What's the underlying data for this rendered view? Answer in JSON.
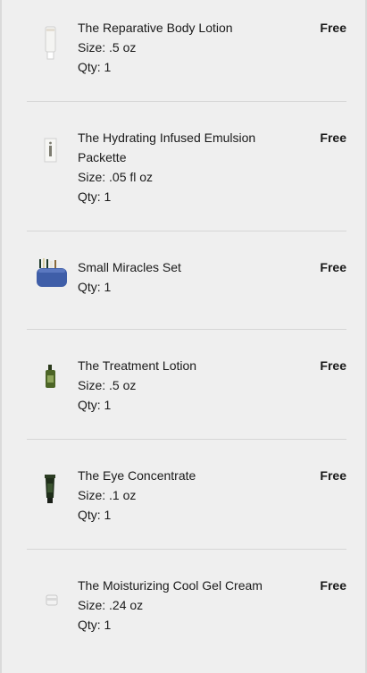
{
  "items": [
    {
      "name": "The Reparative Body Lotion",
      "size": "Size: .5 oz",
      "qty": "Qty: 1",
      "price": "Free",
      "icon": "lotion-tube-icon"
    },
    {
      "name": "The Hydrating Infused Emulsion Packette",
      "size": "Size: .05 fl oz",
      "qty": "Qty: 1",
      "price": "Free",
      "icon": "packette-icon"
    },
    {
      "name": "Small Miracles Set",
      "qty": "Qty: 1",
      "price": "Free",
      "icon": "gift-set-icon"
    },
    {
      "name": "The Treatment Lotion",
      "size": "Size: .5 oz",
      "qty": "Qty: 1",
      "price": "Free",
      "icon": "bottle-icon"
    },
    {
      "name": "The Eye Concentrate",
      "size": "Size: .1 oz",
      "qty": "Qty: 1",
      "price": "Free",
      "icon": "eye-tube-icon"
    },
    {
      "name": "The Moisturizing Cool Gel Cream",
      "size": "Size: .24 oz",
      "qty": "Qty: 1",
      "price": "Free",
      "icon": "jar-icon"
    }
  ]
}
